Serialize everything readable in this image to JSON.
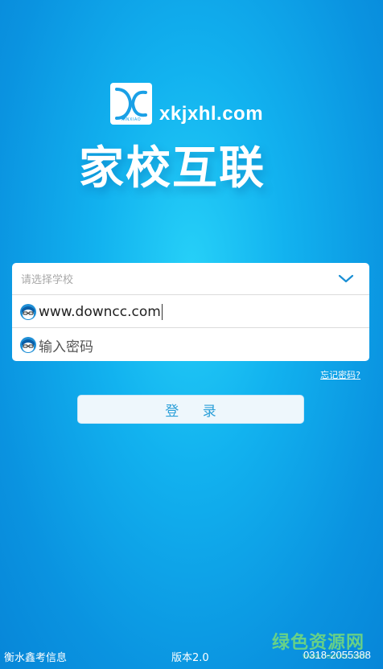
{
  "header": {
    "logo_caption": "XINXIAO",
    "domain": "xkjxhl.com",
    "app_title": "家校互联"
  },
  "form": {
    "school_placeholder": "请选择学校",
    "username_value": "www.downcc.com",
    "password_placeholder": "输入密码"
  },
  "forgot_password": "忘记密码?",
  "login_button": "登 录",
  "footer": {
    "company": "衡水鑫考信息",
    "version": "版本2.0",
    "phone": "0318-2055388"
  },
  "watermark": {
    "text": "绿色资源网",
    "url": "www.downcc.com"
  },
  "colors": {
    "background": "#12b2ef",
    "button_text": "#2a9fd8",
    "watermark": "#78dc78"
  },
  "icons": {
    "dropdown": "chevron-down-icon",
    "user": "user-avatar-icon",
    "password": "password-avatar-icon"
  }
}
